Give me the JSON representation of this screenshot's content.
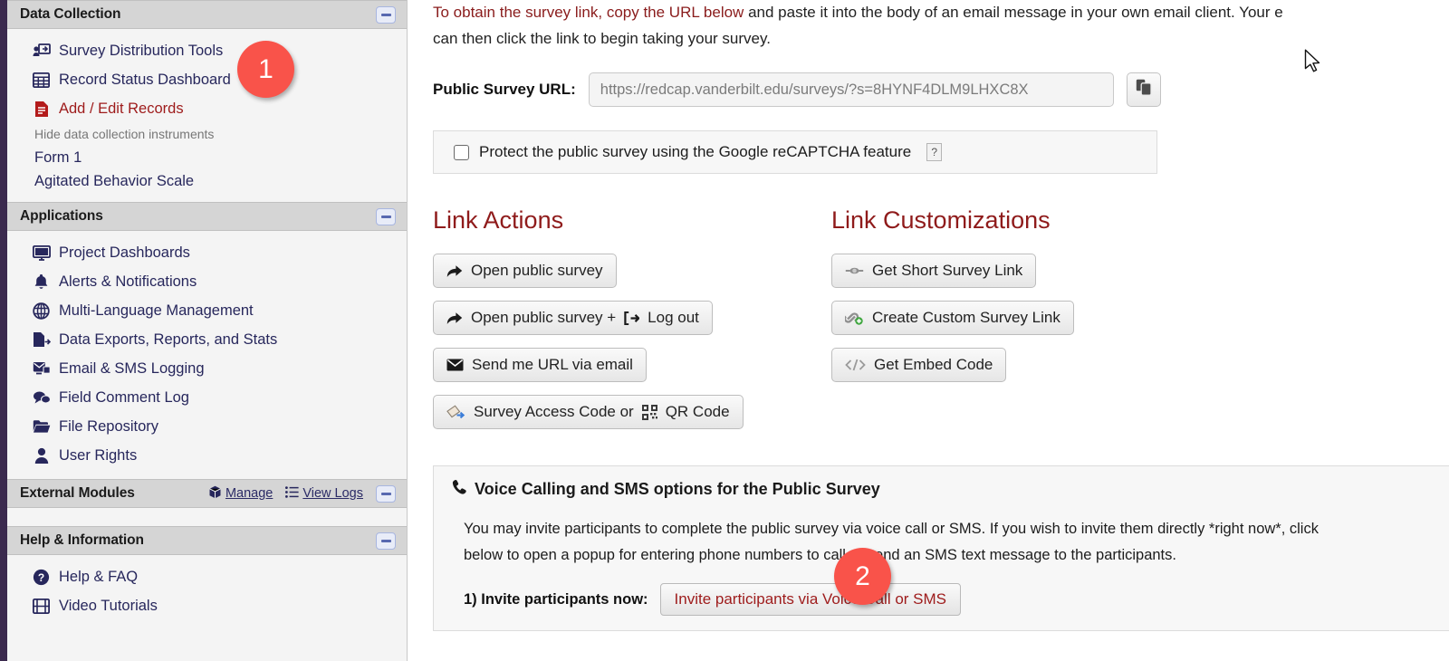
{
  "sidebar": {
    "sections": [
      {
        "title": "Data Collection",
        "collapse_icon": "minus-icon",
        "items": [
          {
            "label": "Survey Distribution Tools",
            "icon": "person-screen-icon",
            "style": "normal"
          },
          {
            "label": "Record Status Dashboard",
            "icon": "grid-table-icon",
            "style": "normal"
          },
          {
            "label": "Add / Edit Records",
            "icon": "red-document-icon",
            "style": "red"
          }
        ],
        "sub_label": "Hide data collection instruments",
        "forms": [
          "Form 1",
          "Agitated Behavior Scale"
        ]
      },
      {
        "title": "Applications",
        "collapse_icon": "minus-icon",
        "items": [
          {
            "label": "Project Dashboards",
            "icon": "monitor-icon",
            "style": "normal"
          },
          {
            "label": "Alerts & Notifications",
            "icon": "bell-icon",
            "style": "normal"
          },
          {
            "label": "Multi-Language Management",
            "icon": "globe-icon",
            "style": "normal"
          },
          {
            "label": "Data Exports, Reports, and Stats",
            "icon": "document-export-icon",
            "style": "normal"
          },
          {
            "label": "Email & SMS Logging",
            "icon": "email-stack-icon",
            "style": "normal"
          },
          {
            "label": "Field Comment Log",
            "icon": "comments-icon",
            "style": "normal"
          },
          {
            "label": "File Repository",
            "icon": "folder-open-icon",
            "style": "normal"
          },
          {
            "label": "User Rights",
            "icon": "user-icon",
            "style": "normal"
          }
        ]
      },
      {
        "title": "External Modules",
        "collapse_icon": "minus-icon",
        "links": [
          {
            "label": "Manage",
            "icon": "cube-icon"
          },
          {
            "label": "View Logs",
            "icon": "list-icon"
          }
        ],
        "items": []
      },
      {
        "title": "Help & Information",
        "collapse_icon": "minus-icon",
        "items": [
          {
            "label": "Help & FAQ",
            "icon": "question-circle-icon",
            "style": "normal"
          },
          {
            "label": "Video Tutorials",
            "icon": "film-icon",
            "style": "normal"
          }
        ]
      }
    ]
  },
  "main": {
    "intro_highlight": "To obtain the survey link, copy the URL below",
    "intro_rest": " and paste it into the body of an email message in your own email client. Your e",
    "intro_line2": "can then click the link to begin taking your survey.",
    "url_label": "Public Survey URL:",
    "url_value": "https://redcap.vanderbilt.edu/surveys/?s=8HYNF4DLM9LHXC8X",
    "copy_button_icon": "copy-clipboard-icon",
    "captcha": {
      "label": "Protect the public survey using the Google reCAPTCHA feature",
      "help_badge": "?",
      "checked": false
    },
    "link_actions": {
      "title": "Link Actions",
      "buttons": [
        {
          "label": "Open public survey",
          "icon": "share-arrow-icon"
        },
        {
          "label": "Open public survey + ",
          "label2": "Log out",
          "icon": "share-arrow-icon",
          "icon2": "logout-icon"
        },
        {
          "label": "Send me URL via email",
          "icon": "envelope-icon"
        },
        {
          "label": "Survey Access Code or ",
          "label2": "QR Code",
          "icon": "ticket-icon",
          "icon2": "qr-code-icon"
        }
      ]
    },
    "link_customizations": {
      "title": "Link Customizations",
      "buttons": [
        {
          "label": "Get Short Survey Link",
          "icon": "link-chain-icon"
        },
        {
          "label": "Create Custom Survey Link",
          "icon": "link-add-icon"
        },
        {
          "label": "Get Embed Code",
          "icon": "code-icon"
        }
      ]
    },
    "voice_panel": {
      "title": "Voice Calling and SMS options for the Public Survey",
      "title_icon": "phone-icon",
      "paragraph_line1": "You may invite participants to complete the public survey via voice call or SMS. If you wish to invite them directly *right now*, click",
      "paragraph_line2": "below to open a popup for entering phone numbers to call or send an SMS text message to the participants.",
      "step_label": "1) Invite participants now:",
      "step_button": "Invite participants via Voice Call or SMS"
    }
  },
  "annotations": {
    "badges": [
      {
        "number": "1",
        "color": "#f9534a"
      },
      {
        "number": "2",
        "color": "#f9534a"
      }
    ]
  },
  "cursor": {
    "icon": "mouse-pointer-icon"
  }
}
